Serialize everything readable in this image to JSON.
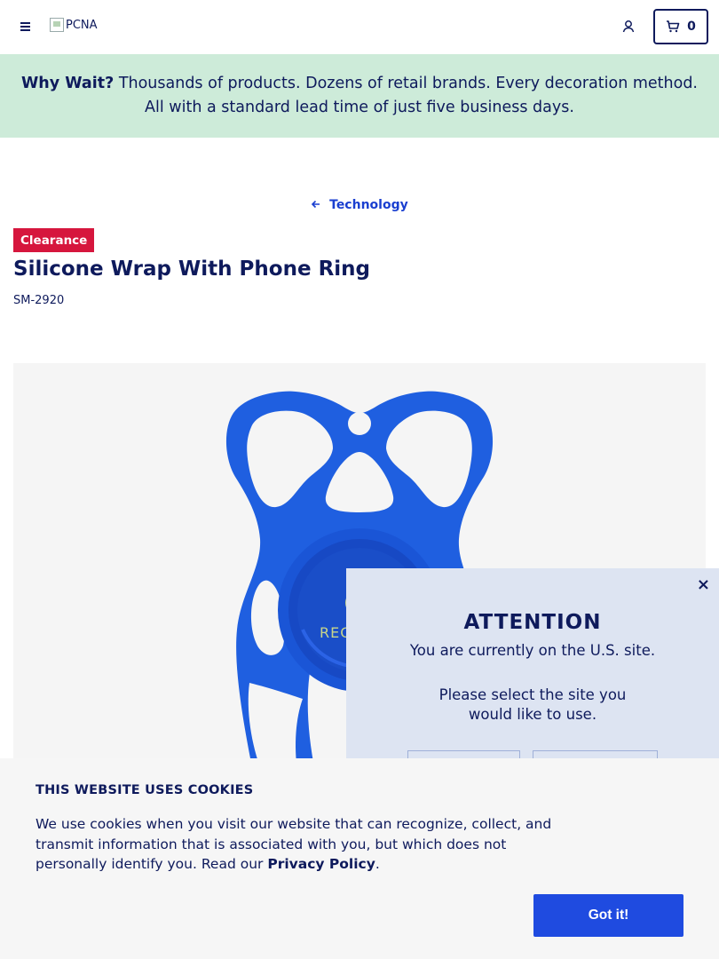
{
  "header": {
    "logo_alt": "PCNA",
    "cart_count": "0"
  },
  "banner": {
    "lead": "Why Wait?",
    "text": " Thousands of products. Dozens of retail brands. Every decoration method. All with a standard lead time of just five business days."
  },
  "breadcrumb": {
    "label": "Technology"
  },
  "product": {
    "badge": "Clearance",
    "title": "Silicone Wrap With Phone Ring",
    "sku": "SM-2920",
    "imprint_text": "REG"
  },
  "modal": {
    "close_label": "×",
    "title": "ATTENTION",
    "line1": "You are currently on the U.S. site.",
    "line2": "Please select the site you would like to use."
  },
  "cookie": {
    "title": "THIS WEBSITE USES COOKIES",
    "text_before": "We use cookies when you visit our website that can recognize, collect, and transmit information that is associated with you, but which does not personally identify you. Read our ",
    "link": "Privacy Policy",
    "text_after": ".",
    "button": "Got it!"
  },
  "colors": {
    "navy": "#0e1a5c",
    "banner_bg": "#cdebd9",
    "badge_red": "#d6163d",
    "link_blue": "#1a3fd0",
    "button_blue": "#1f4be0",
    "product_blue": "#1f5fe0"
  },
  "icons": {
    "menu": "hamburger-icon",
    "user": "user-icon",
    "cart": "cart-icon",
    "back": "arrow-left-icon",
    "close": "close-icon"
  }
}
